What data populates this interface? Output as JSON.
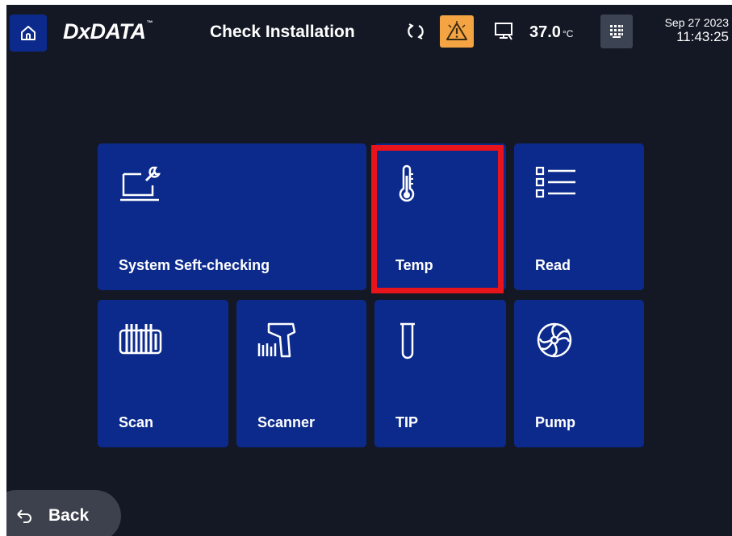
{
  "header": {
    "home_icon": "home-icon",
    "brand": "DxDATA",
    "brand_mark": "™",
    "title": "Check Installation",
    "sync_icon": "sync-icon",
    "alarm_icon": "warning-icon",
    "alarm_color": "#f5a443",
    "device_icon": "device-icon",
    "temperature": "37.0",
    "temperature_unit": "°C",
    "keypad_icon": "keypad-icon",
    "date": "Sep 27 2023",
    "time": "11:43:25"
  },
  "tiles": [
    {
      "id": "system",
      "label": "System Seft-checking",
      "icon": "laptop-wrench-icon"
    },
    {
      "id": "temp",
      "label": "Temp",
      "icon": "thermometer-icon",
      "highlighted": true
    },
    {
      "id": "read",
      "label": "Read",
      "icon": "list-icon"
    },
    {
      "id": "scan",
      "label": "Scan",
      "icon": "barcode-icon"
    },
    {
      "id": "scanner",
      "label": "Scanner",
      "icon": "barcode-scanner-icon"
    },
    {
      "id": "tip",
      "label": "TIP",
      "icon": "tube-icon"
    },
    {
      "id": "pump",
      "label": "Pump",
      "icon": "fan-icon"
    }
  ],
  "colors": {
    "background": "#141824",
    "tile": "#0c2a8c",
    "highlight": "#e8141b"
  },
  "back": {
    "label": "Back",
    "icon": "back-arrow-icon"
  }
}
